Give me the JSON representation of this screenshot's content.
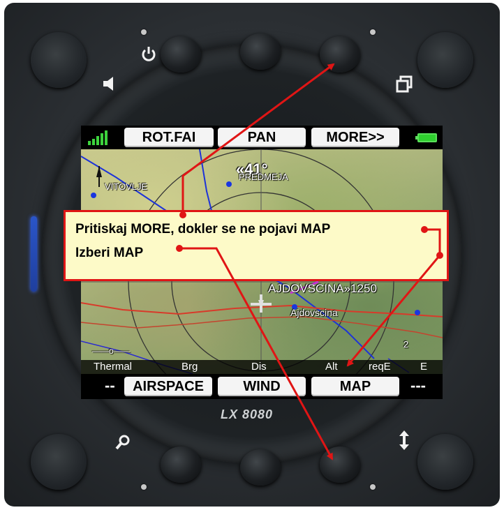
{
  "device": {
    "brand": "LX 8080",
    "icons": [
      "power-icon",
      "speaker-icon",
      "pages-icon",
      "zoom-icon",
      "up-down-arrows-icon"
    ]
  },
  "top_menu": {
    "signal_icon": "signal-bars-icon",
    "buttons": [
      "ROT.FAI",
      "PAN",
      "MORE>>"
    ],
    "battery_icon": "battery-icon"
  },
  "map": {
    "labels": {
      "vitovlje": "VITOVLJE",
      "wind": "«41°",
      "waypoint": "PREDMEJA",
      "ajdovscina_alt": "AJDOVSCINA»1250",
      "ajdovscina": "Ajdovscina",
      "scale_left": "——o——",
      "scale_right": "2"
    }
  },
  "nav_bar": {
    "labels": [
      "Thermal",
      "Brg",
      "Dis",
      "Alt",
      "reqE",
      "E"
    ]
  },
  "bottom_menu": {
    "left_dash": "--",
    "buttons": [
      "AIRSPACE",
      "WIND",
      "MAP"
    ],
    "right_dash": "---"
  },
  "callout": {
    "line1": "Pritiskaj MORE, dokler se ne pojavi MAP",
    "line2": "Izberi MAP"
  },
  "colors": {
    "annotation": "#e01515",
    "callout_bg": "#fdfac8",
    "signal": "#3dd33d"
  }
}
